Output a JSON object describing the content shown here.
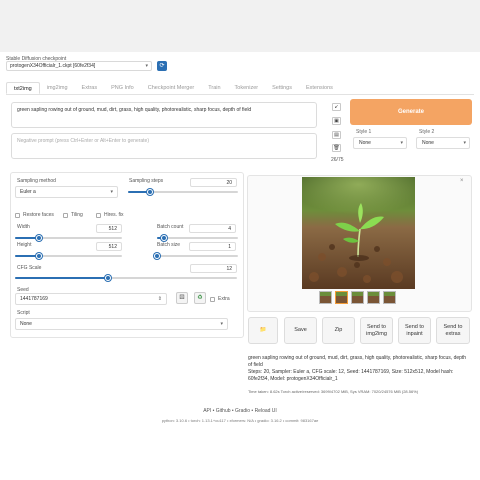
{
  "checkpoint": {
    "label": "Stable Diffusion checkpoint",
    "value": "protogenX34Officialr_1.ckpt [60fe2f34]",
    "refresh_icon": "refresh-icon"
  },
  "tabs": [
    "txt2img",
    "img2img",
    "Extras",
    "PNG Info",
    "Checkpoint Merger",
    "Train",
    "Tokenizer",
    "Settings",
    "Extensions"
  ],
  "active_tab": "txt2img",
  "prompt": {
    "value": "green sapling rowing out of ground, mud, dirt, grass, high quality, photorealistic, sharp focus, depth of field",
    "negative_placeholder": "Negative prompt (press Ctrl+Enter or Alt+Enter to generate)",
    "token_count": "26/75"
  },
  "toolbar": {
    "icons": [
      "arrow-icon",
      "folder-icon",
      "paste-icon",
      "trash-icon"
    ],
    "arrow_glyph": "↙",
    "folder_glyph": "▣",
    "paste_glyph": "▤",
    "trash_glyph": "🗑"
  },
  "generate": {
    "label": "Generate",
    "color": "#f4a463"
  },
  "styles": {
    "style1_label": "Style 1",
    "style1_value": "None",
    "style2_label": "Style 2",
    "style2_value": "None"
  },
  "params": {
    "sampling_method_label": "Sampling method",
    "sampling_method_value": "Euler a",
    "sampling_steps_label": "Sampling steps",
    "sampling_steps_value": "20",
    "restore_faces": "Restore faces",
    "tiling": "Tiling",
    "hires_fix": "Hires. fix",
    "width_label": "Width",
    "width_value": "512",
    "height_label": "Height",
    "height_value": "512",
    "batch_count_label": "Batch count",
    "batch_count_value": "4",
    "batch_size_label": "Batch size",
    "batch_size_value": "1",
    "cfg_label": "CFG Scale",
    "cfg_value": "12",
    "seed_label": "Seed",
    "seed_value": "1441787169",
    "extra_label": "Extra",
    "script_label": "Script",
    "script_value": "None",
    "dice_glyph": "⚄",
    "recycle_glyph": "♻"
  },
  "sliders": {
    "sampling_steps": 0.2,
    "width": 0.22,
    "height": 0.22,
    "batch_count": 0.09,
    "batch_size": 0.0,
    "cfg": 0.42
  },
  "gallery": {
    "close_glyph": "×",
    "thumbnail_count": 5
  },
  "actions": {
    "folder_glyph": "📁",
    "save": "Save",
    "zip": "Zip",
    "send_img2img": "Send to img2img",
    "send_inpaint": "Send to inpaint",
    "send_extras": "Send to extras"
  },
  "output_info": {
    "prompt": "green sapling rowing out of ground, mud, dirt, grass, high quality, photorealistic, sharp focus, depth of field",
    "params": "Steps: 20, Sampler: Euler a, CFG scale: 12, Seed: 1441787169, Size: 512x512, Model hash: 60fe2f34, Model: protogenX34Officialr_1",
    "time": "Time taken: 8.62s  Torch active/reserved: 3699/4702 MiB, Sys VRAM: 7020/24576 MiB (28.56%)"
  },
  "footer": {
    "links": "API  •  Github  •  Gradio  •  Reload UI",
    "versions": "python: 3.10.6  •  torch: 1.13.1+cu117  •  xformers: N/A  •  gradio: 3.16.2  •  commit: 983167ae"
  }
}
